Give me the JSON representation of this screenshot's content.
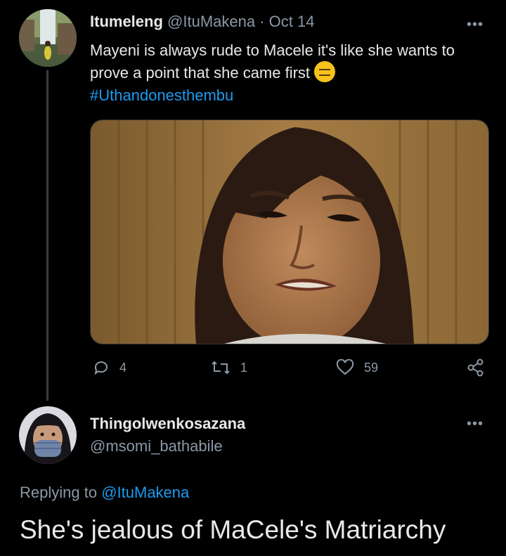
{
  "tweet": {
    "author_name": "Itumeleng",
    "author_handle": "@ItuMakena",
    "separator": "·",
    "date": "Oct 14",
    "text": "Mayeni is always rude to Macele it's like she wants to prove a point that she came first",
    "emoji": "expressionless-face",
    "hashtag": "#Uthandonesthembu",
    "actions": {
      "replies": "4",
      "retweets": "1",
      "likes": "59"
    },
    "more_label": "•••"
  },
  "reply": {
    "author_name": "Thingolwenkosazana",
    "author_handle": "@msomi_bathabile",
    "replying_prefix": "Replying to",
    "replying_handle": "@ItuMakena",
    "text": "She's jealous of MaCele's Matriarchy",
    "more_label": "•••"
  },
  "colors": {
    "background": "#000000",
    "text": "#e7e9ea",
    "muted": "#8b98a5",
    "link": "#1d9bf0"
  }
}
